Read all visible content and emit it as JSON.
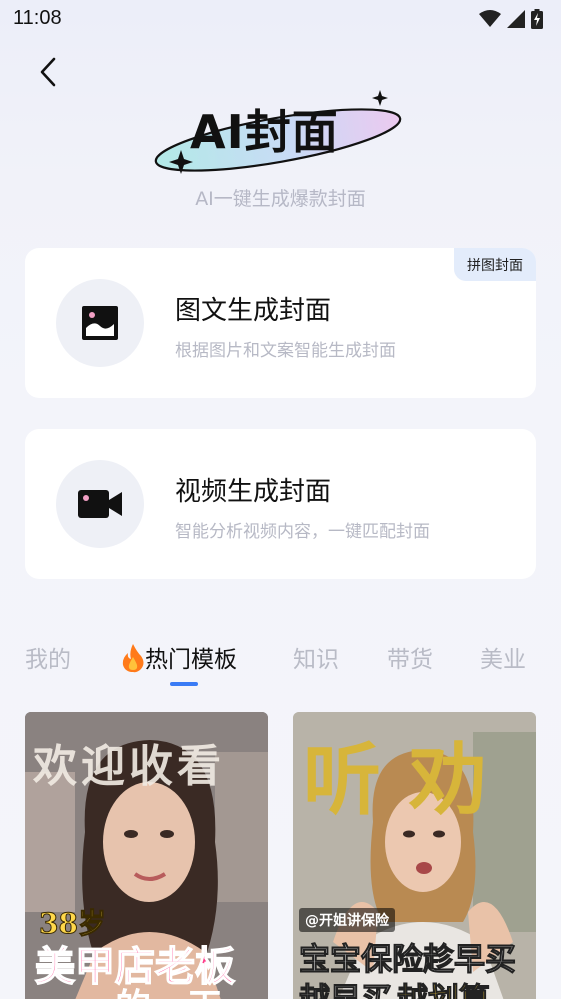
{
  "status_bar": {
    "time": "11:08"
  },
  "header": {
    "logo_text": "AI封面",
    "subtitle": "AI一键生成爆款封面"
  },
  "cards": [
    {
      "icon": "image-icon",
      "title": "图文生成封面",
      "description": "根据图片和文案智能生成封面",
      "badge": "拼图封面"
    },
    {
      "icon": "video-camera-icon",
      "title": "视频生成封面",
      "description": "智能分析视频内容，一键匹配封面"
    }
  ],
  "tabs": [
    {
      "label": "我的",
      "active": false
    },
    {
      "label": "热门模板",
      "active": true,
      "icon": "fire-icon"
    },
    {
      "label": "知识",
      "active": false
    },
    {
      "label": "带货",
      "active": false
    },
    {
      "label": "美业",
      "active": false
    }
  ],
  "templates": [
    {
      "headline": "欢迎收看",
      "line1": "38岁",
      "line2": "美甲店老板",
      "line3": "的一天"
    },
    {
      "headline": "听劝",
      "handle": "@开姐讲保险",
      "line1": "宝宝保险趁早买",
      "line2_a": "越早买",
      "line2_b": "越划算"
    }
  ],
  "colors": {
    "accent": "#3a7bf5",
    "badge_bg": "#e3ecfb",
    "muted_text": "#b7b9c5"
  }
}
